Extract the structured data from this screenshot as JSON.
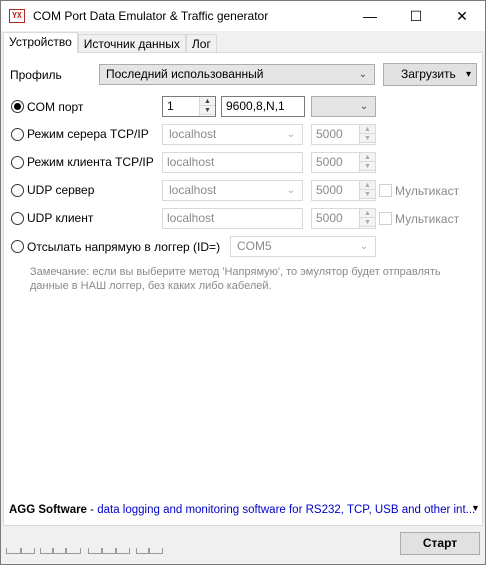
{
  "window": {
    "icon": "YX",
    "title": "COM Port Data Emulator & Traffic generator",
    "controls": {
      "minimize": "—",
      "maximize": "☐",
      "close": "✕"
    }
  },
  "tabs": [
    {
      "label": "Устройство",
      "active": true
    },
    {
      "label": "Источник данных",
      "active": false
    },
    {
      "label": "Лог",
      "active": false
    }
  ],
  "profile": {
    "label": "Профиль",
    "value": "Последний использованный",
    "load_button": "Загрузить",
    "load_arrow": "▾"
  },
  "connections": {
    "com_port": {
      "label": "COM порт",
      "selected": true,
      "port_number": "1",
      "settings": "9600,8,N,1",
      "dropdown_value": ""
    },
    "tcp_server": {
      "label": "Режим серера TCP/IP",
      "host": "localhost",
      "port": "5000"
    },
    "tcp_client": {
      "label": "Режим клиента TCP/IP",
      "host": "localhost",
      "port": "5000"
    },
    "udp_server": {
      "label": "UDP сервер",
      "host": "localhost",
      "port": "5000",
      "multicast_label": "Мультикаст"
    },
    "udp_client": {
      "label": "UDP клиент",
      "host": "localhost",
      "port": "5000",
      "multicast_label": "Мультикаст"
    },
    "direct_logger": {
      "label": "Отсылать напрямую в логгер (ID=)",
      "value": "COM5"
    }
  },
  "note": {
    "line1": "Замечание: если вы выберите метод 'Напрямую', то эмулятор будет отправлять",
    "line2": "данные в НАШ логгер, без каких либо кабелей."
  },
  "footer": {
    "brand": "AGG Software",
    "separator": " - ",
    "link": "data logging and monitoring software for RS232, TCP, USB and other int...",
    "start_button": "Старт"
  },
  "icons": {
    "spin_up": "▲",
    "spin_down": "▼",
    "combo_arrow": "⌄",
    "scroll_arrow": "▼"
  }
}
